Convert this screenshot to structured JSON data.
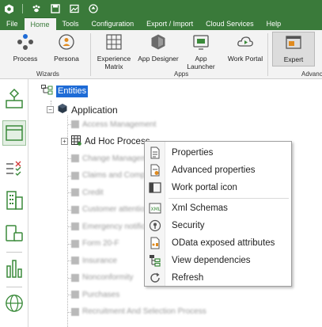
{
  "titlebar": {
    "icons": [
      "app-logo-icon",
      "paw-icon",
      "save-icon",
      "image-icon",
      "upload-icon"
    ]
  },
  "menu": {
    "tabs": [
      "File",
      "Home",
      "Tools",
      "Configuration",
      "Export / Import",
      "Cloud Services",
      "Help"
    ],
    "active": "Home"
  },
  "ribbon": {
    "buttons": {
      "process": "Process",
      "persona": "Persona",
      "experience_matrix_1": "Experience",
      "experience_matrix_2": "Matrix",
      "app_designer": "App Designer",
      "app_launcher": "App Launcher",
      "work_portal": "Work Portal",
      "expert": "Expert"
    },
    "groups": {
      "wizards": "Wizards",
      "apps": "Apps",
      "advanced": "Advanc"
    }
  },
  "sidebar": {
    "icons": [
      "process-flow-icon",
      "window-icon",
      "checklist-icon",
      "building-icon",
      "devices-icon",
      "bar-chart-icon",
      "globe-icon"
    ]
  },
  "tree": {
    "root": "Entities",
    "application": "Application",
    "items": [
      "Access Management",
      "Ad Hoc Process",
      "Change Management",
      "Claims and Complaints",
      "Credit",
      "Customer attention",
      "Emergency notification",
      "Form 20-F",
      "Insurance",
      "Nonconformity",
      "Purchases",
      "Recruitment And Selection Process"
    ],
    "selected_index": 1
  },
  "context_menu": {
    "items": [
      {
        "label": "Properties",
        "icon": "document-icon"
      },
      {
        "label": "Advanced properties",
        "icon": "advanced-properties-icon"
      },
      {
        "label": "Work portal icon",
        "icon": "portal-icon"
      },
      {
        "label": "Xml Schemas",
        "icon": "xml-schema-icon"
      },
      {
        "label": "Security",
        "icon": "security-icon"
      },
      {
        "label": "OData exposed attributes",
        "icon": "odata-icon"
      },
      {
        "label": "View dependencies",
        "icon": "dependencies-icon"
      },
      {
        "label": "Refresh",
        "icon": "refresh-icon"
      }
    ]
  }
}
